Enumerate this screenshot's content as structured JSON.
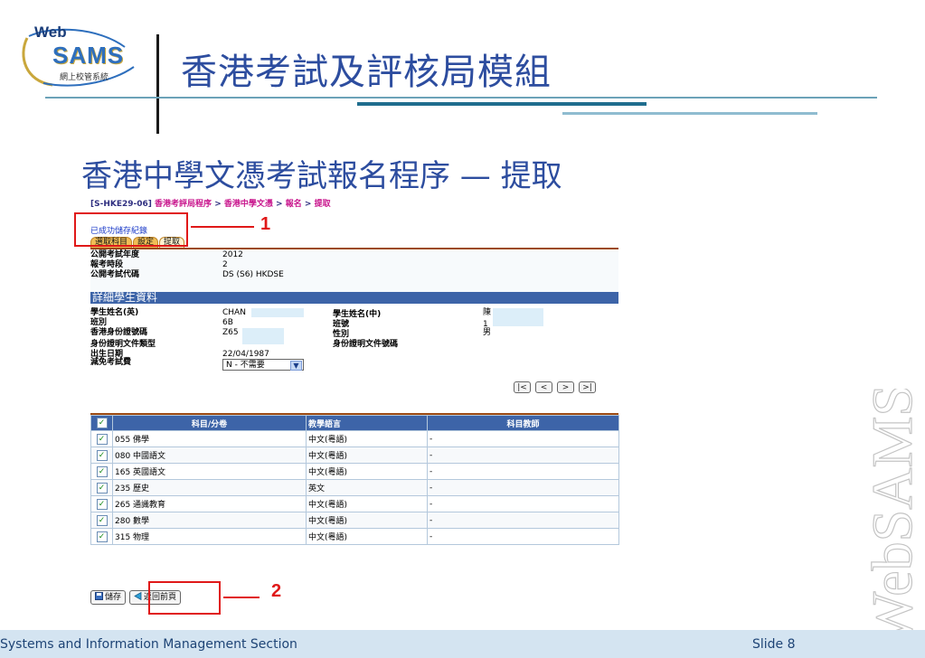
{
  "slide": {
    "title": "香港考試及評核局模組",
    "subtitle": "香港中學文憑考試報名程序 — 提取",
    "footer_left": "Systems and Information Management Section",
    "footer_right": "Slide 8",
    "watermark": "WebSAMS",
    "logo": {
      "top": "Web",
      "main": "SAMS",
      "sub": "網上校管系統"
    }
  },
  "app": {
    "screen_id": "[S-HKE29-06]",
    "breadcrumb": [
      "香港考評局程序",
      "香港中學文憑",
      "報名",
      "提取"
    ],
    "breadcrumb_sep": ">",
    "status_message": "已成功儲存紀錄",
    "tabs": [
      "選取科目",
      "設定",
      "提取"
    ],
    "exam_info": [
      {
        "label": "公開考試年度",
        "value": "2012"
      },
      {
        "label": "報考時段",
        "value": "2"
      },
      {
        "label": "公開考試代碼",
        "value": "DS (S6) HKDSE"
      }
    ],
    "section_title": "詳細學生資料",
    "student": {
      "name_en_label": "學生姓名(英)",
      "name_en_value": "CHAN",
      "name_zh_label": "學生姓名(中)",
      "name_zh_value": "陳",
      "class_label": "班別",
      "class_value": "6B",
      "class_no_label": "班號",
      "class_no_value": "1",
      "hkid_label": "香港身份證號碼",
      "hkid_value": "Z65",
      "sex_label": "性別",
      "sex_value": "男",
      "id_type_label": "身份證明文件類型",
      "id_no_label": "身份證明文件號碼",
      "dob_label": "出生日期",
      "dob_value": "22/04/1987",
      "fee_label": "減免考試費",
      "fee_value": "N - 不需要"
    },
    "nav_buttons": [
      "|<",
      "<",
      ">",
      ">|"
    ],
    "table": {
      "headers": [
        "科目/分卷",
        "教學語言",
        "科目教師"
      ],
      "rows": [
        {
          "subject": "055 佛學",
          "language": "中文(粵語)",
          "teacher": "-"
        },
        {
          "subject": "080 中國語文",
          "language": "中文(粵語)",
          "teacher": "-"
        },
        {
          "subject": "165 英國語文",
          "language": "中文(粵語)",
          "teacher": "-"
        },
        {
          "subject": "235 歷史",
          "language": "英文",
          "teacher": "-"
        },
        {
          "subject": "265 通識教育",
          "language": "中文(粵語)",
          "teacher": "-"
        },
        {
          "subject": "280 數學",
          "language": "中文(粵語)",
          "teacher": "-"
        },
        {
          "subject": "315 物理",
          "language": "中文(粵語)",
          "teacher": "-"
        }
      ]
    },
    "buttons": {
      "save": "儲存",
      "back": "返回前頁"
    },
    "annotations": [
      "1",
      "2"
    ]
  }
}
